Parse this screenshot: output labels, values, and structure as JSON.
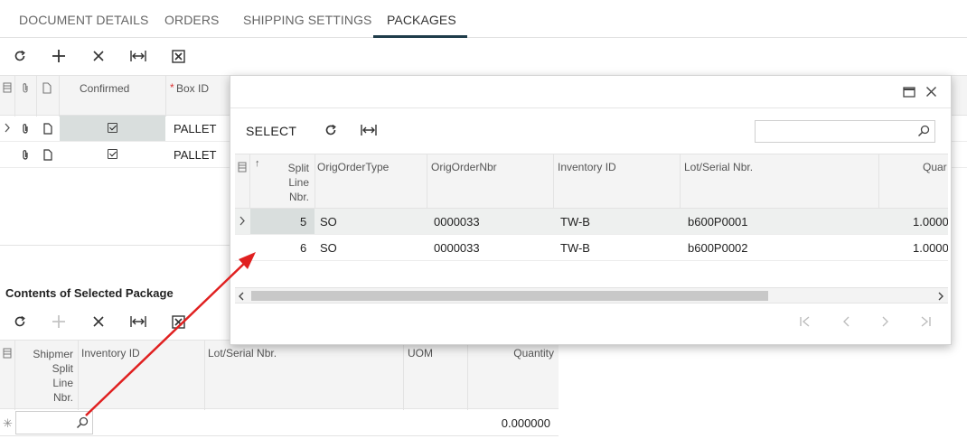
{
  "tabs": [
    {
      "label": "DOCUMENT DETAILS"
    },
    {
      "label": "ORDERS"
    },
    {
      "label": "SHIPPING SETTINGS"
    },
    {
      "label": "PACKAGES"
    }
  ],
  "packages_grid": {
    "columns": {
      "confirmed": "Confirmed",
      "required_marker": "*",
      "box_id": "Box ID"
    },
    "rows": [
      {
        "box_id": "PALLET",
        "confirmed": true,
        "selected": true
      },
      {
        "box_id": "PALLET",
        "confirmed": true,
        "selected": false
      }
    ]
  },
  "contents": {
    "title": "Contents of Selected Package",
    "columns": {
      "shipment_split_line": [
        "Shipmer",
        "Split",
        "Line",
        "Nbr."
      ],
      "inventory_id": "Inventory ID",
      "lot_serial": "Lot/Serial Nbr.",
      "uom": "UOM",
      "quantity": "Quantity"
    },
    "new_row": {
      "quantity": "0.000000"
    }
  },
  "dialog": {
    "select_label": "SELECT",
    "search_placeholder": "",
    "columns": {
      "split_line": [
        "Split",
        "Line",
        "Nbr."
      ],
      "sort_marker": "↑",
      "orig_order_type": "OrigOrderType",
      "orig_order_nbr": "OrigOrderNbr",
      "inventory_id": "Inventory ID",
      "lot_serial": "Lot/Serial Nbr.",
      "quantity": "Quar"
    },
    "rows": [
      {
        "split_line": "5",
        "orig_order_type": "SO",
        "orig_order_nbr": "0000033",
        "inventory_id": "TW-B",
        "lot_serial": "b600P0001",
        "quantity": "1.0000"
      },
      {
        "split_line": "6",
        "orig_order_type": "SO",
        "orig_order_nbr": "0000033",
        "inventory_id": "TW-B",
        "lot_serial": "b600P0002",
        "quantity": "1.0000"
      }
    ]
  },
  "colors": {
    "annotation_arrow": "#e02020",
    "tab_active": "#1f3c4a"
  }
}
